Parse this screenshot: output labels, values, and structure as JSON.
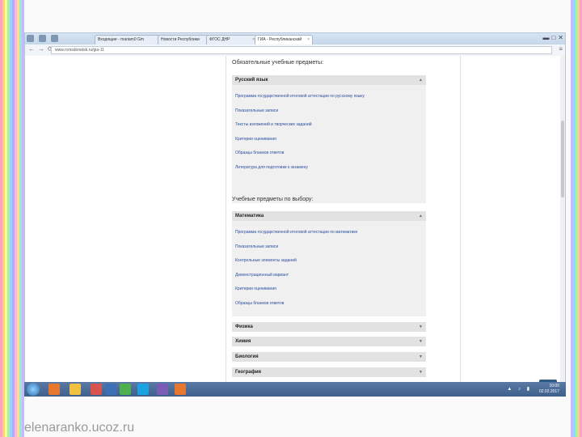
{
  "watermark": "elenaranko.ucoz.ru",
  "browser": {
    "tabs": [
      {
        "label": "Входящие - mariam0 Gm"
      },
      {
        "label": "Новости Республики"
      },
      {
        "label": "ФГОС ДНР"
      },
      {
        "label": "ГИА - Республиканский"
      }
    ],
    "url": "www.rcmsdonetsk.ru/gia-11"
  },
  "page": {
    "section1_title": "Обязательные учебные предметы:",
    "russian": {
      "title": "Русский язык",
      "links": [
        "Программа государственной итоговой аттестации по русскому языку",
        "Показательные записи",
        "Тексты изложений и творческих заданий",
        "Критерии оценивания",
        "Образцы бланков ответов",
        "Литература для подготовки к экзамену"
      ]
    },
    "section2_title": "Учебные предметы по выбору:",
    "math": {
      "title": "Математика",
      "links": [
        "Программа государственной итоговой аттестации по математике",
        "Показательные записи",
        "Контрольные элементы заданий",
        "Демонстрационный вариант",
        "Критерии оценивания",
        "Образцы бланков ответов"
      ]
    },
    "collapsed": [
      "Физика",
      "Химия",
      "Биология",
      "География"
    ]
  },
  "taskbar": {
    "time": "10:00",
    "date": "02.02.2017",
    "icon_colors": [
      "#e8772e",
      "#f0c040",
      "#d9534f",
      "#3b6fb6",
      "#4caf50",
      "#1aa3e0",
      "#7b5bb5"
    ]
  }
}
